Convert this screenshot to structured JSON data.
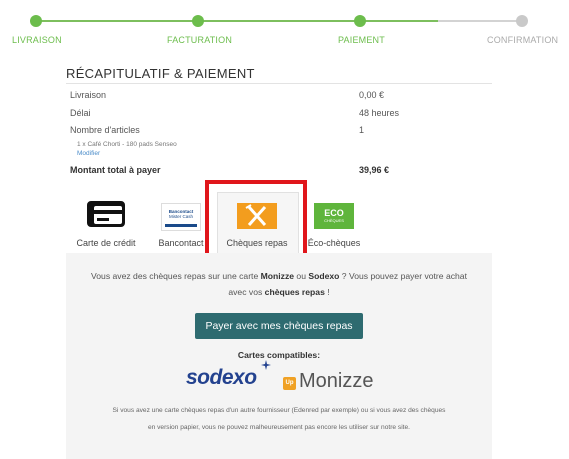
{
  "steps": [
    {
      "label": "LIVRAISON",
      "state": "done"
    },
    {
      "label": "FACTURATION",
      "state": "done"
    },
    {
      "label": "PAIEMENT",
      "state": "current"
    },
    {
      "label": "CONFIRMATION",
      "state": "pending"
    }
  ],
  "colors": {
    "accent": "#6cbd4c",
    "button": "#2e6b70",
    "highlight": "#e0161b",
    "sodexo": "#23428f",
    "monizze": "#f0a124"
  },
  "recap": {
    "title": "RÉCAPITULATIF & PAIEMENT",
    "rows": [
      {
        "label": "Livraison",
        "value": "0,00 €"
      },
      {
        "label": "Délai",
        "value": "48 heures"
      },
      {
        "label": "Nombre d'articles",
        "value": "1"
      }
    ],
    "item": "1 x Café Chorti - 180 pads Senseo",
    "modify": "Modifier",
    "total_label": "Montant total à payer",
    "total_value": "39,96 €"
  },
  "payment_tabs": [
    {
      "label": "Carte de crédit",
      "icon": "credit-card-icon"
    },
    {
      "label": "Bancontact",
      "icon": "bancontact-icon",
      "logo_text": "Bancontact",
      "logo_sub": "Mister Cash"
    },
    {
      "label": "Chèques repas",
      "icon": "fork-knife-icon",
      "selected": true
    },
    {
      "label": "Éco-chèques",
      "icon": "eco-icon",
      "logo_text": "ECO",
      "logo_sub": "CHÈQUES"
    }
  ],
  "panel": {
    "intro_1": "Vous avez des chèques repas sur une carte Monizze ou Sodexo ? Vous pouvez payer votre achat",
    "intro_2": "avec vos chèques repas !",
    "pay_button": "Payer avec mes chèques repas",
    "compatible": "Cartes compatibles:",
    "sodexo": "sodexo",
    "monizze_badge": "Up",
    "monizze": "Monizze",
    "note_1": "Si vous avez une carte chèques repas d'un autre fournisseur (Edenred par exemple) ou si vous avez des chèques",
    "note_2": "en version papier, vous ne pouvez malheureusement pas encore les utiliser sur notre site."
  }
}
